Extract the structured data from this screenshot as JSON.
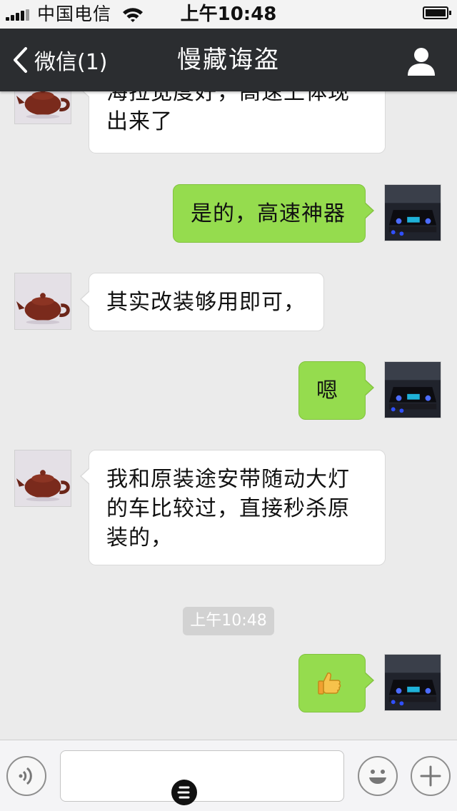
{
  "status_bar": {
    "carrier": "中国电信",
    "time": "上午10:48"
  },
  "nav": {
    "back_label": "微信(1)",
    "title": "慢藏诲盗"
  },
  "messages": [
    {
      "side": "in",
      "text": "海拉宽度好，高速上体现出来了",
      "avatar": "teapot-avatar"
    },
    {
      "side": "out",
      "text": "是的，高速神器",
      "avatar": "car-avatar"
    },
    {
      "side": "in",
      "text": "其实改装够用即可，",
      "avatar": "teapot-avatar"
    },
    {
      "side": "out",
      "text": "嗯",
      "avatar": "car-avatar"
    },
    {
      "side": "in",
      "text": "我和原装途安带随动大灯的车比较过，直接秒杀原装的，",
      "avatar": "teapot-avatar"
    },
    {
      "side": "out",
      "text": "",
      "emoji": "thumbs-up-icon",
      "avatar": "car-avatar"
    }
  ],
  "timestamp": "上午10:48",
  "input_bar": {
    "voice_icon": "voice-icon",
    "emoji_icon": "smiley-icon",
    "plus_icon": "plus-icon",
    "text_value": ""
  },
  "colors": {
    "nav_bg": "#2b2d30",
    "chat_bg": "#ebebeb",
    "out_bubble": "#95dc4e",
    "in_bubble": "#ffffff"
  }
}
